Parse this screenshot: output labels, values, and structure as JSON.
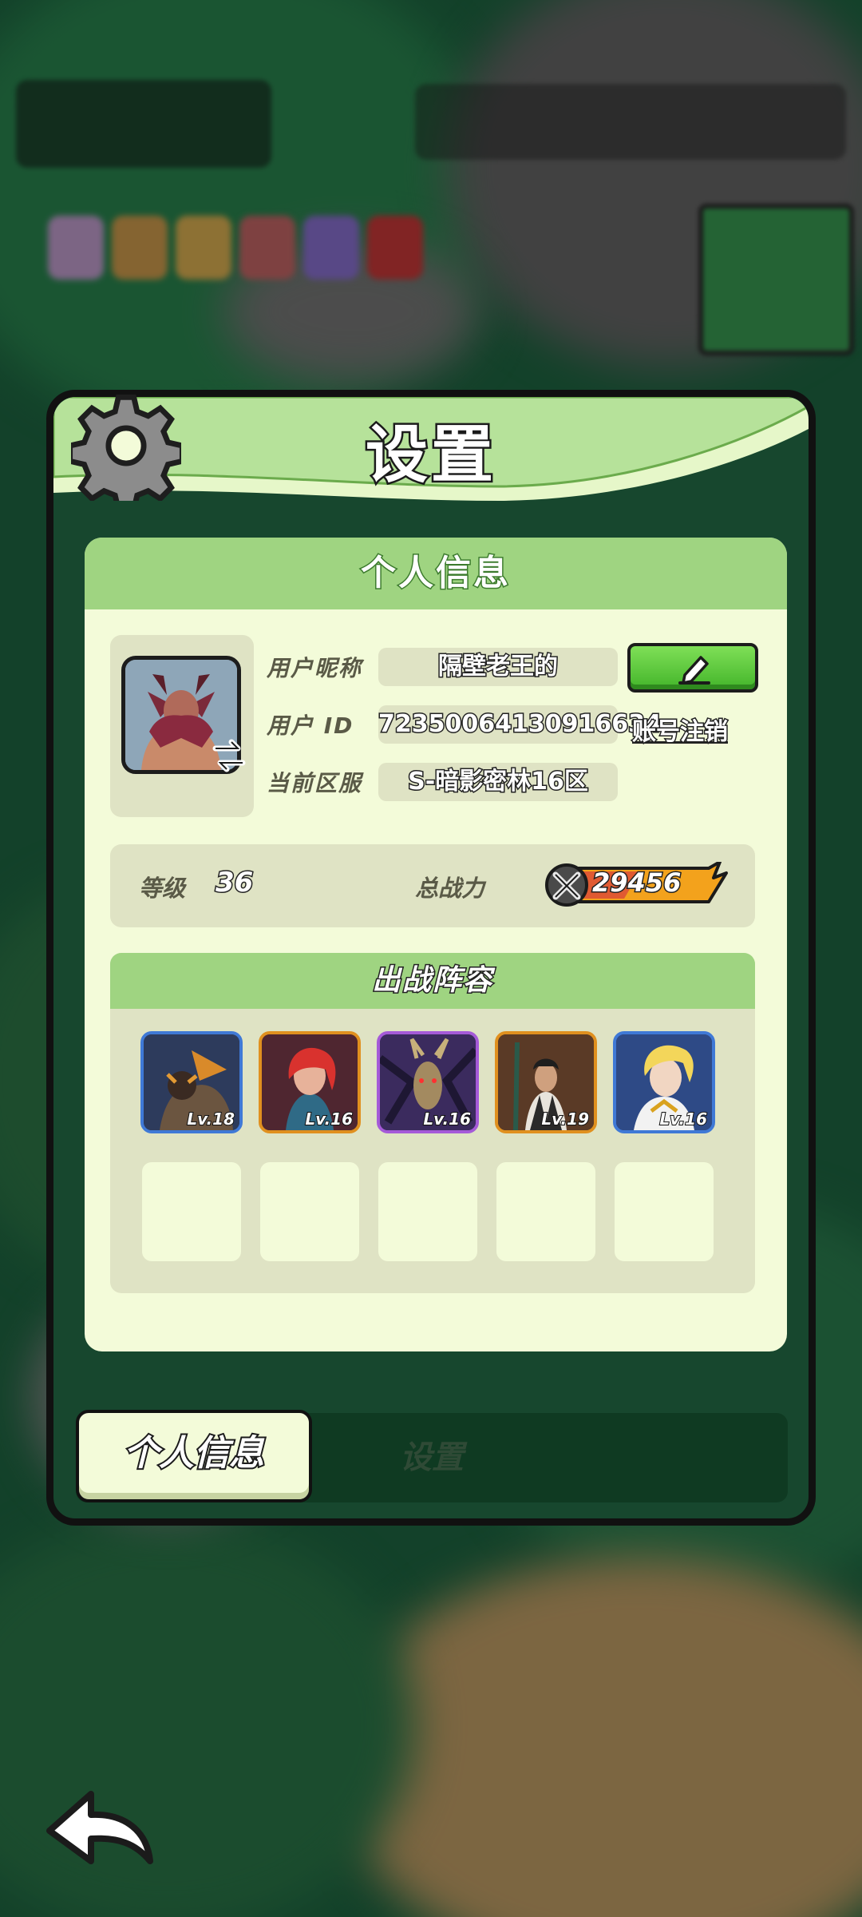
{
  "panel": {
    "title": "设置",
    "card_title": "个人信息"
  },
  "profile": {
    "nickname_label": "用户昵称",
    "nickname": "隔壁老王的",
    "id_label": "用户 ID",
    "user_id": "72350064130916634",
    "deregister_label": "账号注销",
    "server_label": "当前区服",
    "server": "S-暗影密林16区"
  },
  "stats": {
    "level_label": "等级",
    "level": "36",
    "power_label": "总战力",
    "power": "29456"
  },
  "lineup": {
    "title": "出战阵容",
    "heroes": [
      {
        "level": "Lv.18",
        "rarity_color": "#3f79d6"
      },
      {
        "level": "Lv.16",
        "rarity_color": "#e0901f"
      },
      {
        "level": "Lv.16",
        "rarity_color": "#a55ad8"
      },
      {
        "level": "Lv.19",
        "rarity_color": "#e0901f"
      },
      {
        "level": "Lv.16",
        "rarity_color": "#3f79d6"
      }
    ],
    "empty_slots": 5
  },
  "tabs": {
    "profile": "个人信息",
    "settings": "设置"
  },
  "icons": [
    "gear-icon",
    "swap-icon",
    "pencil-icon",
    "swords-icon",
    "back-arrow-icon"
  ]
}
